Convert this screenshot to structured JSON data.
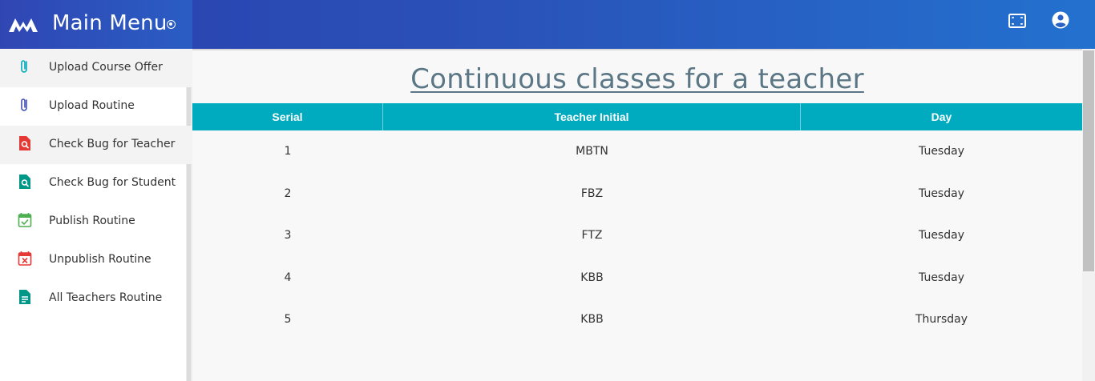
{
  "header": {
    "title": "Main Menu",
    "logo_icon": "m-logo-icon",
    "toggle_icon": "radio-toggle-icon",
    "fullscreen_icon": "fullscreen-icon",
    "account_icon": "account-circle-icon",
    "colors": {
      "bar_start": "#2b3fae",
      "bar_end": "#2371cf"
    }
  },
  "sidebar": {
    "items": [
      {
        "label": "Upload Course Offer",
        "icon": "paperclip-icon",
        "color": "#00aabf"
      },
      {
        "label": "Upload Routine",
        "icon": "paperclip-icon",
        "color": "#3f51b5"
      },
      {
        "label": "Check Bug for Teacher",
        "icon": "search-file-icon",
        "color": "#e53935"
      },
      {
        "label": "Check Bug for Student",
        "icon": "search-file-icon",
        "color": "#009688"
      },
      {
        "label": "Publish Routine",
        "icon": "calendar-check-icon",
        "color": "#4caf50"
      },
      {
        "label": "Unpublish Routine",
        "icon": "calendar-remove-icon",
        "color": "#e53935"
      },
      {
        "label": "All Teachers Routine",
        "icon": "document-icon",
        "color": "#009688"
      }
    ]
  },
  "main": {
    "title": "Continuous classes for a teacher",
    "table": {
      "columns": [
        "Serial",
        "Teacher Initial",
        "Day"
      ],
      "rows": [
        {
          "serial": "1",
          "teacher": "MBTN",
          "day": "Tuesday"
        },
        {
          "serial": "2",
          "teacher": "FBZ",
          "day": "Tuesday"
        },
        {
          "serial": "3",
          "teacher": "FTZ",
          "day": "Tuesday"
        },
        {
          "serial": "4",
          "teacher": "KBB",
          "day": "Tuesday"
        },
        {
          "serial": "5",
          "teacher": "KBB",
          "day": "Thursday"
        }
      ],
      "header_color": "#00aabf"
    }
  }
}
